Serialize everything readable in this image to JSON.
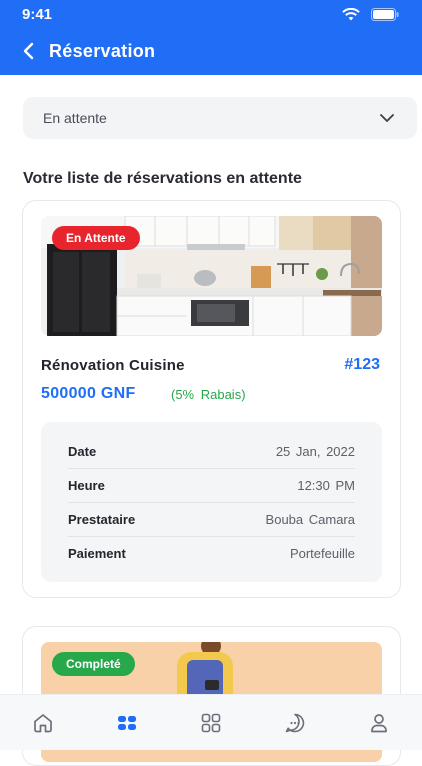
{
  "status_bar": {
    "time": "9:41"
  },
  "header": {
    "title": "Réservation",
    "back_icon": "chevron-left-icon"
  },
  "filter": {
    "selected": "En attente",
    "icon": "chevron-down-icon"
  },
  "section_title": "Votre liste de réservations en attente",
  "bookings": [
    {
      "status": "En Attente",
      "status_color": "#e8252d",
      "service": "Rénovation Cuisine",
      "id": "#123",
      "price": "500000 GNF",
      "discount": "(5%  Rabais)",
      "details": [
        {
          "label": "Date",
          "value": "25 Jan, 2022"
        },
        {
          "label": "Heure",
          "value": "12:30 PM"
        },
        {
          "label": "Prestataire",
          "value": "Bouba  Camara"
        },
        {
          "label": "Paiement",
          "value": "Portefeuille"
        }
      ]
    },
    {
      "status": "Completé",
      "status_color": "#27a84a"
    }
  ],
  "bottom_nav": {
    "items": [
      {
        "icon": "home-icon"
      },
      {
        "icon": "bookings-icon",
        "active": true
      },
      {
        "icon": "categories-icon"
      },
      {
        "icon": "chat-icon"
      },
      {
        "icon": "profile-icon"
      }
    ]
  },
  "colors": {
    "primary": "#1f6ef5",
    "pending": "#e8252d",
    "completed": "#27a84a"
  }
}
